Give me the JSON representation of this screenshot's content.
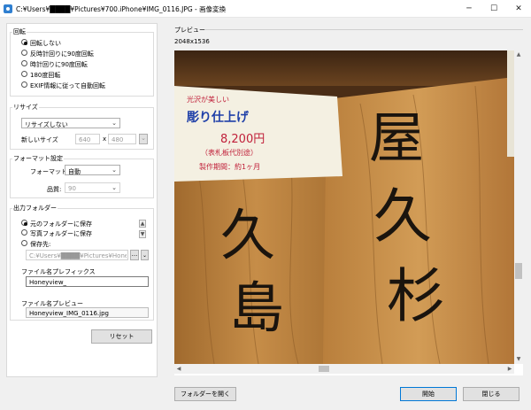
{
  "window": {
    "title": "C:¥Users¥████¥Pictures¥700.iPhone¥IMG_0116.JPG - 画像変換",
    "minimize_glyph": "─",
    "maximize_glyph": "☐",
    "close_glyph": "✕"
  },
  "rotation": {
    "title": "回転",
    "options": [
      "回転しない",
      "反時計回りに90度回転",
      "時計回りに90度回転",
      "180度回転",
      "EXIF情報に従って自動回転"
    ],
    "selected_index": 0
  },
  "resize": {
    "title": "リサイズ",
    "mode": "リサイズしない",
    "new_size_label": "新しいサイズ",
    "width": "640",
    "times": "x",
    "height": "480",
    "dropdown_glyph": "⌄"
  },
  "format": {
    "title": "フォーマット設定",
    "format_label": "フォーマット:",
    "format_value": "自動",
    "quality_label": "品質:",
    "quality_value": "90",
    "dropdown_glyph": "⌄"
  },
  "output": {
    "title": "出力フォルダー",
    "options": [
      "元のフォルダーに保存",
      "写真フォルダーに保存",
      "保存先:"
    ],
    "selected_index": 0,
    "path": "C:¥Users¥████¥Pictures¥Honeyview",
    "browse_label": "...",
    "up_glyph": "▲",
    "down_glyph": "▼",
    "prefix_label": "ファイル名プレフィックス",
    "prefix_value": "Honeyview_",
    "filename_preview_label": "ファイル名プレビュー",
    "filename_preview_value": "Honeyview_IMG_0116.jpg"
  },
  "reset_label": "リセット",
  "preview": {
    "title": "プレビュー",
    "dimensions": "2048x1536",
    "sign_lines": [
      "光沢が美しい",
      "彫り仕上げ",
      "8,200円",
      "（表札板代別途）",
      "製作期間：約1ヶ月"
    ],
    "carved_left": [
      "久",
      "島"
    ],
    "carved_right": [
      "屋",
      "久",
      "杉"
    ]
  },
  "scroll": {
    "up": "▲",
    "down": "▼",
    "left": "◀",
    "right": "▶"
  },
  "buttons": {
    "open_folder": "フォルダーを開く",
    "start": "開始",
    "close": "閉じる"
  }
}
